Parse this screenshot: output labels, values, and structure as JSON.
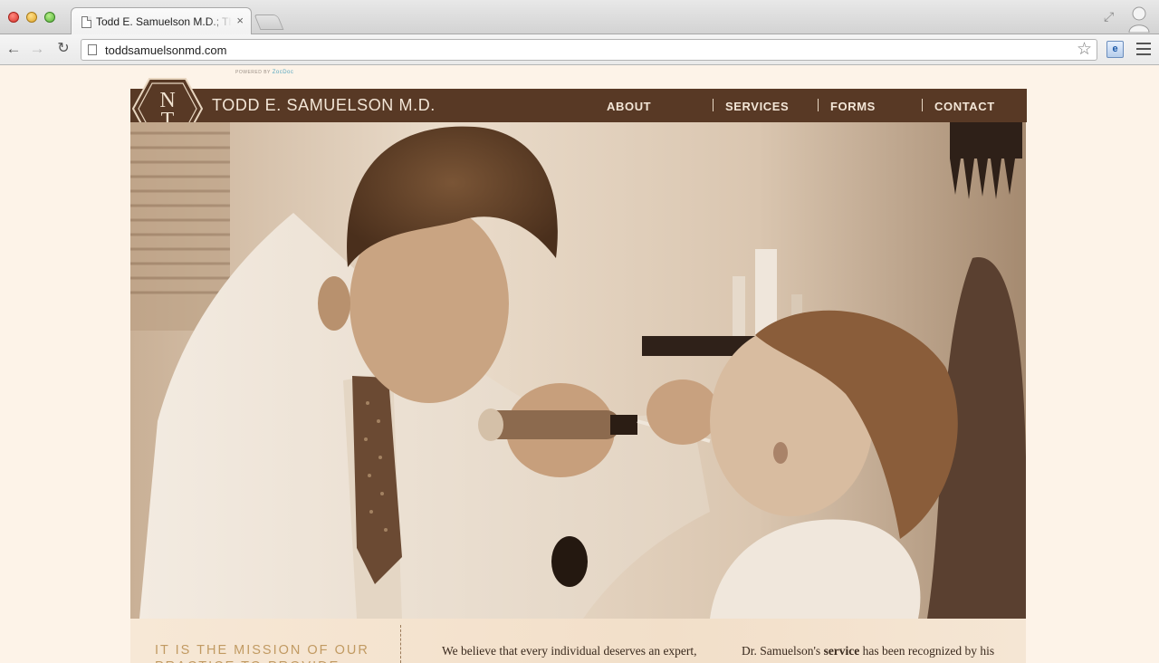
{
  "browser": {
    "tab": {
      "title": "Todd E. Samuelson M.D.; The"
    },
    "tab_close": "×",
    "address_bar": {
      "url": "toddsamuelsonmd.com"
    },
    "nav": {
      "back": "←",
      "forward": "→",
      "reload": "↻"
    },
    "bookmark_star": "☆",
    "restore": "⤢",
    "extension_label": "e"
  },
  "page": {
    "powered_by": {
      "prefix": "POWERED BY",
      "brand": "ZocDoc"
    },
    "site_title": "TODD E. SAMUELSON M.D.",
    "logo_letters": [
      "N",
      "T"
    ],
    "nav": [
      {
        "label": "ABOUT"
      },
      {
        "label": "SERVICES"
      },
      {
        "label": "FORMS"
      },
      {
        "label": "CONTACT"
      }
    ],
    "mission": {
      "heading": "IT IS THE MISSION OF OUR PRACTICE TO PROVIDE",
      "col1": "We believe that every individual deserves an expert, caring and compassionate physician.",
      "col2_prefix": "Dr. Samuelson's",
      "col2_bold": "service",
      "col2_suffix": "has been recognized by his peers and patients alike."
    },
    "hero_image": {
      "description_icon": "photo"
    }
  },
  "colors": {
    "header_brown": "#583925",
    "page_bg": "#fdf3e8",
    "accent_gold": "#c19a62",
    "header_text": "#f3e6d7"
  }
}
